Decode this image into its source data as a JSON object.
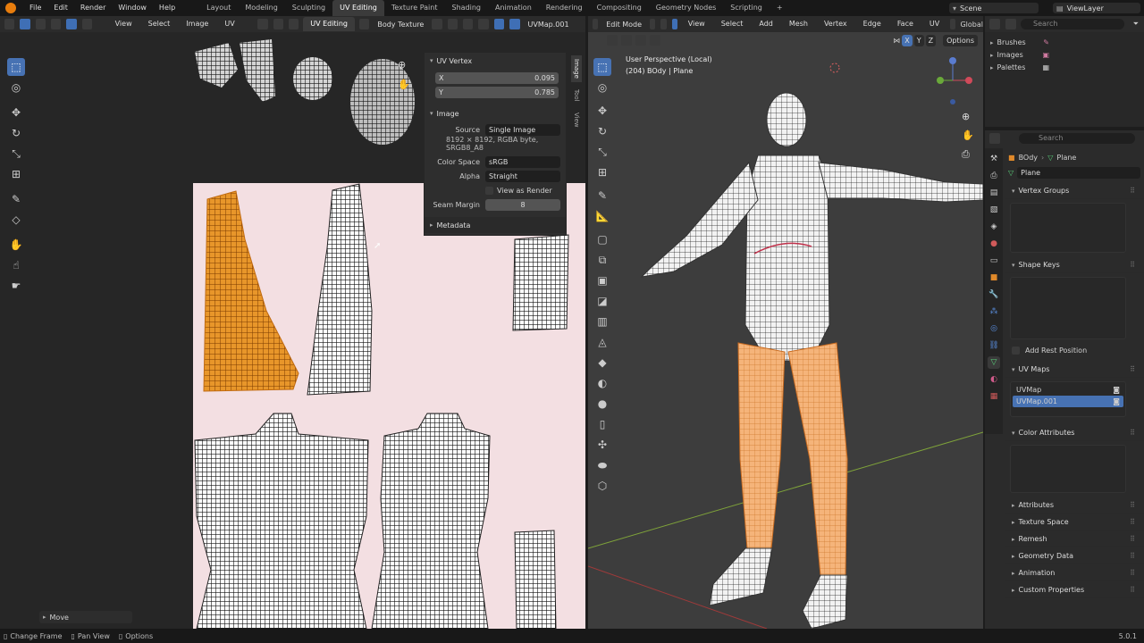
{
  "menubar": {
    "menus": [
      "File",
      "Edit",
      "Render",
      "Window",
      "Help"
    ],
    "workspaces": [
      "Layout",
      "Modeling",
      "Sculpting",
      "UV Editing",
      "Texture Paint",
      "Shading",
      "Animation",
      "Rendering",
      "Compositing",
      "Geometry Nodes",
      "Scripting"
    ],
    "active_workspace": "UV Editing",
    "add_tab": "+",
    "scene": "Scene",
    "view_layer": "ViewLayer"
  },
  "uv_editor": {
    "menus": [
      "View",
      "Select",
      "Image",
      "UV"
    ],
    "image_name": "Body Texture",
    "uv_map": "UVMap.001",
    "operator_panel": "Move",
    "n_panel": {
      "uv_vertex_title": "UV Vertex",
      "x_label": "X",
      "x_value": "0.095",
      "y_label": "Y",
      "y_value": "0.785",
      "image_title": "Image",
      "source_label": "Source",
      "source_value": "Single Image",
      "info": "8192 × 8192,  RGBA byte, SRGB8_A8",
      "color_space_label": "Color Space",
      "color_space_value": "sRGB",
      "alpha_label": "Alpha",
      "alpha_value": "Straight",
      "view_as_render": "View as Render",
      "seam_margin_label": "Seam Margin",
      "seam_margin_value": "8",
      "metadata_title": "Metadata",
      "tabs": [
        "Image",
        "Tool",
        "View"
      ]
    }
  },
  "viewport": {
    "mode": "Edit Mode",
    "menus": [
      "View",
      "Select",
      "Add",
      "Mesh",
      "Vertex",
      "Edge",
      "Face",
      "UV"
    ],
    "orientation": "Global",
    "axes": [
      "X",
      "Y",
      "Z"
    ],
    "options_label": "Options",
    "perspective_label": "User Perspective (Local)",
    "object_label": "(204) BOdy | Plane"
  },
  "outliner": {
    "search_placeholder": "Search",
    "items": [
      "Brushes",
      "Images",
      "Palettes"
    ]
  },
  "properties": {
    "search_placeholder": "Search",
    "breadcrumb_object": "BOdy",
    "breadcrumb_mesh": "Plane",
    "mesh_name": "Plane",
    "sections": {
      "vertex_groups": "Vertex Groups",
      "shape_keys": "Shape Keys",
      "add_rest_position": "Add Rest Position",
      "uv_maps": "UV Maps",
      "color_attributes": "Color Attributes"
    },
    "uv_maps": [
      "UVMap",
      "UVMap.001"
    ],
    "active_uv_map": "UVMap.001",
    "collapsed_sections": [
      "Attributes",
      "Texture Space",
      "Remesh",
      "Geometry Data",
      "Animation",
      "Custom Properties"
    ]
  },
  "statusbar": {
    "items": [
      "Change Frame",
      "Pan View",
      "Options"
    ],
    "version": "5.0.1"
  },
  "colors": {
    "accent": "#4772b3",
    "selection": "#e8962a",
    "uv_background": "#f3dfe2",
    "active_tab": "#3b3b3b"
  }
}
